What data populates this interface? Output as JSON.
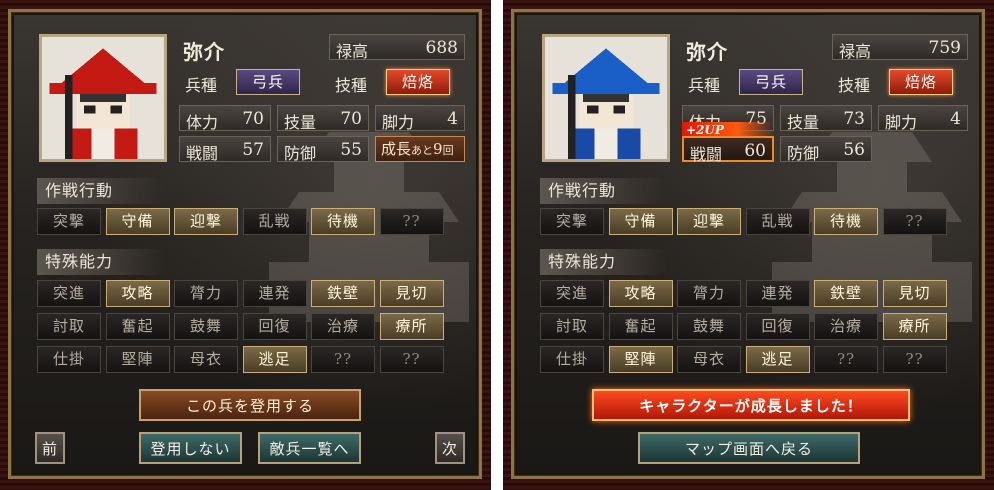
{
  "left": {
    "name": "弥介",
    "roku_label": "禄高",
    "roku_value": "688",
    "heishu_label": "兵種",
    "heishu_value": "弓兵",
    "gihou_label": "技種",
    "gihou_value": "焙烙",
    "stats": {
      "tairyoku": {
        "label": "体力",
        "value": "70"
      },
      "giryou": {
        "label": "技量",
        "value": "70"
      },
      "kyakuryoku": {
        "label": "脚力",
        "value": "4"
      },
      "sentou": {
        "label": "戦闘",
        "value": "57"
      },
      "bougyo": {
        "label": "防御",
        "value": "55"
      }
    },
    "growth_main": "成長",
    "growth_small": "あと",
    "growth_count": "9",
    "growth_unit": "回",
    "tactics_title": "作戦行動",
    "tactics": [
      {
        "label": "突撃",
        "state": "off"
      },
      {
        "label": "守備",
        "state": "on"
      },
      {
        "label": "迎撃",
        "state": "on"
      },
      {
        "label": "乱戦",
        "state": "off"
      },
      {
        "label": "待機",
        "state": "on"
      },
      {
        "label": "??",
        "state": "q"
      }
    ],
    "abilities_title": "特殊能力",
    "abilities": [
      {
        "label": "突進",
        "state": "off"
      },
      {
        "label": "攻略",
        "state": "on"
      },
      {
        "label": "膂力",
        "state": "off"
      },
      {
        "label": "連発",
        "state": "off"
      },
      {
        "label": "鉄壁",
        "state": "on"
      },
      {
        "label": "見切",
        "state": "on"
      },
      {
        "label": "討取",
        "state": "off"
      },
      {
        "label": "奮起",
        "state": "off"
      },
      {
        "label": "鼓舞",
        "state": "off"
      },
      {
        "label": "回復",
        "state": "off"
      },
      {
        "label": "治療",
        "state": "off"
      },
      {
        "label": "療所",
        "state": "on"
      },
      {
        "label": "仕掛",
        "state": "off"
      },
      {
        "label": "堅陣",
        "state": "off"
      },
      {
        "label": "母衣",
        "state": "off"
      },
      {
        "label": "逃足",
        "state": "on"
      },
      {
        "label": "??",
        "state": "q"
      },
      {
        "label": "??",
        "state": "q"
      }
    ],
    "recruit_button": "この兵を登用する",
    "prev_button": "前",
    "no_recruit_button": "登用しない",
    "enemy_list_button": "敵兵一覧へ",
    "next_button": "次",
    "hat_color": "#c41a14",
    "body_color": "#c41a14"
  },
  "right": {
    "name": "弥介",
    "roku_label": "禄高",
    "roku_value": "759",
    "heishu_label": "兵種",
    "heishu_value": "弓兵",
    "gihou_label": "技種",
    "gihou_value": "焙烙",
    "stats": {
      "tairyoku": {
        "label": "体力",
        "value": "75"
      },
      "giryou": {
        "label": "技量",
        "value": "73"
      },
      "kyakuryoku": {
        "label": "脚力",
        "value": "4"
      },
      "sentou": {
        "label": "戦闘",
        "value": "60"
      },
      "bougyo": {
        "label": "防御",
        "value": "56"
      }
    },
    "up_badge": "+2UP",
    "tactics_title": "作戦行動",
    "tactics": [
      {
        "label": "突撃",
        "state": "off"
      },
      {
        "label": "守備",
        "state": "on"
      },
      {
        "label": "迎撃",
        "state": "on"
      },
      {
        "label": "乱戦",
        "state": "off"
      },
      {
        "label": "待機",
        "state": "on"
      },
      {
        "label": "??",
        "state": "q"
      }
    ],
    "abilities_title": "特殊能力",
    "abilities": [
      {
        "label": "突進",
        "state": "off"
      },
      {
        "label": "攻略",
        "state": "on"
      },
      {
        "label": "膂力",
        "state": "off"
      },
      {
        "label": "連発",
        "state": "off"
      },
      {
        "label": "鉄壁",
        "state": "on"
      },
      {
        "label": "見切",
        "state": "on"
      },
      {
        "label": "討取",
        "state": "off"
      },
      {
        "label": "奮起",
        "state": "off"
      },
      {
        "label": "鼓舞",
        "state": "off"
      },
      {
        "label": "回復",
        "state": "off"
      },
      {
        "label": "治療",
        "state": "off"
      },
      {
        "label": "療所",
        "state": "on"
      },
      {
        "label": "仕掛",
        "state": "off"
      },
      {
        "label": "堅陣",
        "state": "on"
      },
      {
        "label": "母衣",
        "state": "off"
      },
      {
        "label": "逃足",
        "state": "on"
      },
      {
        "label": "??",
        "state": "q"
      },
      {
        "label": "??",
        "state": "q"
      }
    ],
    "growth_banner": "キャラクターが成長しました！",
    "map_button": "マップ画面へ戻る",
    "hat_color": "#1a5ec8",
    "body_color": "#1a4aa8"
  }
}
